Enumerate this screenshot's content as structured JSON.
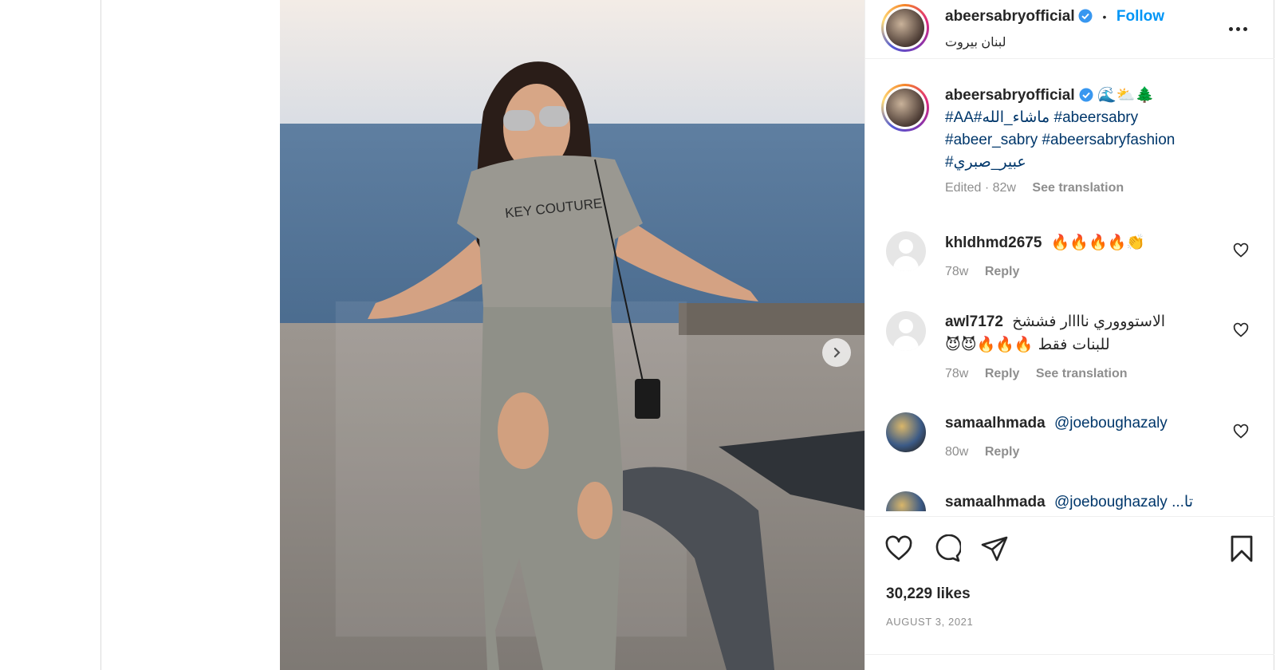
{
  "header": {
    "username": "abeersabryofficial",
    "follow_label": "Follow",
    "separator": "•",
    "location": "لبنان بيروت"
  },
  "photo": {
    "shirt_text": "KEY COUTURE"
  },
  "caption": {
    "username": "abeersabryofficial",
    "emojis": "🌊⛅🌲",
    "tag1": "#AA#ماشاء_الله",
    "tag2": "#abeersabry",
    "tag3": "#abeer_sabry",
    "tag4": "#abeersabryfashion",
    "tag5": "#عبير_صبري",
    "edited": "Edited",
    "age": "82w",
    "see_translation": "See translation"
  },
  "comments": [
    {
      "username": "khldhmd2675",
      "text": "🔥🔥🔥🔥👏",
      "age": "78w",
      "reply": "Reply"
    },
    {
      "username": "awl7172",
      "text": "الاستوووري ناااار فششخ",
      "text2": "للبنات فقط 🔥🔥🔥😈😈",
      "age": "78w",
      "reply": "Reply",
      "see_translation": "See translation"
    },
    {
      "username": "samaalhmada",
      "text": "@joeboughazaly",
      "age": "80w",
      "reply": "Reply"
    },
    {
      "username": "samaalhmada",
      "text": "@joeboughazaly ...تا"
    }
  ],
  "actions": {
    "likes": "30,229 likes",
    "date": "AUGUST 3, 2021"
  },
  "colors": {
    "accent_blue": "#0095f6",
    "tag_blue": "#00376b",
    "muted": "#8e8e8e"
  },
  "icons": [
    "heart-icon",
    "comment-icon",
    "share-icon",
    "bookmark-icon",
    "more-icon",
    "chevron-right-icon",
    "verified-icon"
  ]
}
